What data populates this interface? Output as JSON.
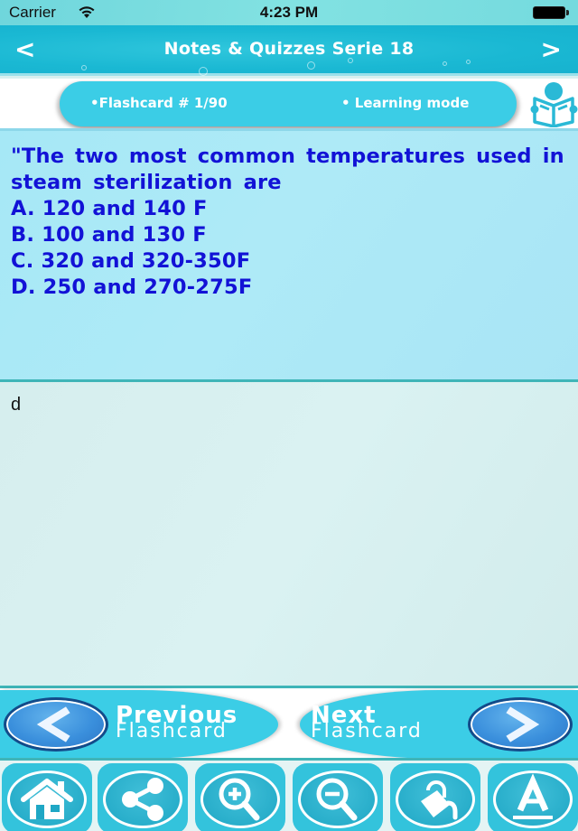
{
  "status_bar": {
    "carrier": "Carrier",
    "time": "4:23 PM",
    "wifi_icon": "wifi-icon",
    "battery_icon": "battery-icon"
  },
  "nav_bar": {
    "back_label": "<",
    "title": "Notes & Quizzes Serie 18",
    "forward_label": ">"
  },
  "info": {
    "flashcard_label": "•Flashcard #  1/90",
    "mode_label": "• Learning mode",
    "reader_icon": "reading-book-icon"
  },
  "question": {
    "stem": "\"The two most common temperatures used in steam sterilization are",
    "options": [
      "A. 120 and 140 F",
      "B. 100 and 130 F",
      "C. 320 and 320-350F",
      "D. 250 and 270-275F"
    ]
  },
  "answer": {
    "text": "d"
  },
  "flash_nav": {
    "previous": {
      "line1": "Previous",
      "line2": "Flashcard"
    },
    "next": {
      "line1": "Next",
      "line2": "Flashcard"
    }
  },
  "toolbar": {
    "buttons": [
      {
        "name": "home",
        "icon": "home-icon"
      },
      {
        "name": "share",
        "icon": "share-icon"
      },
      {
        "name": "zoom-in",
        "icon": "zoom-in-icon"
      },
      {
        "name": "zoom-out",
        "icon": "zoom-out-icon"
      },
      {
        "name": "color-fill",
        "icon": "paint-bucket-icon"
      },
      {
        "name": "font",
        "icon": "font-icon"
      }
    ]
  },
  "colors": {
    "accent": "#3bcde6",
    "nav_bar": "#1ab8d3",
    "question_text": "#1212d6",
    "question_bg": "#a9e7f6",
    "answer_bg": "#d6eeee",
    "divider": "#3fb5b8"
  }
}
